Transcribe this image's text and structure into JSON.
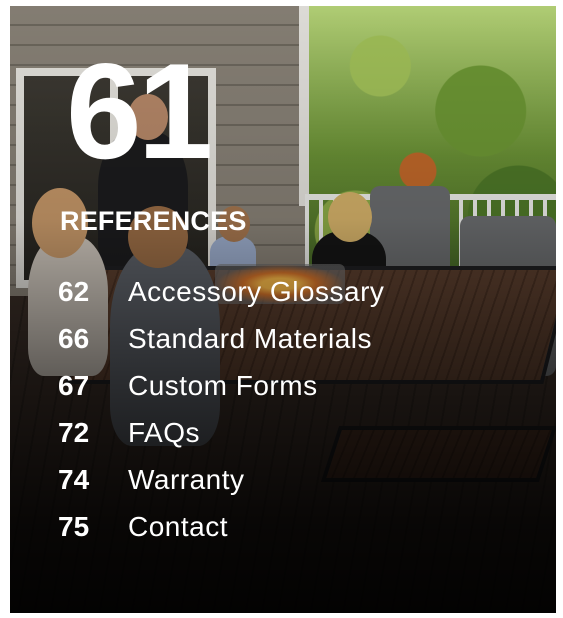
{
  "page_number": "61",
  "section_title": "REFERENCES",
  "toc": [
    {
      "page": "62",
      "label": "Accessory Glossary"
    },
    {
      "page": "66",
      "label": "Standard Materials"
    },
    {
      "page": "67",
      "label": "Custom Forms"
    },
    {
      "page": "72",
      "label": "FAQs"
    },
    {
      "page": "74",
      "label": "Warranty"
    },
    {
      "page": "75",
      "label": "Contact"
    }
  ]
}
